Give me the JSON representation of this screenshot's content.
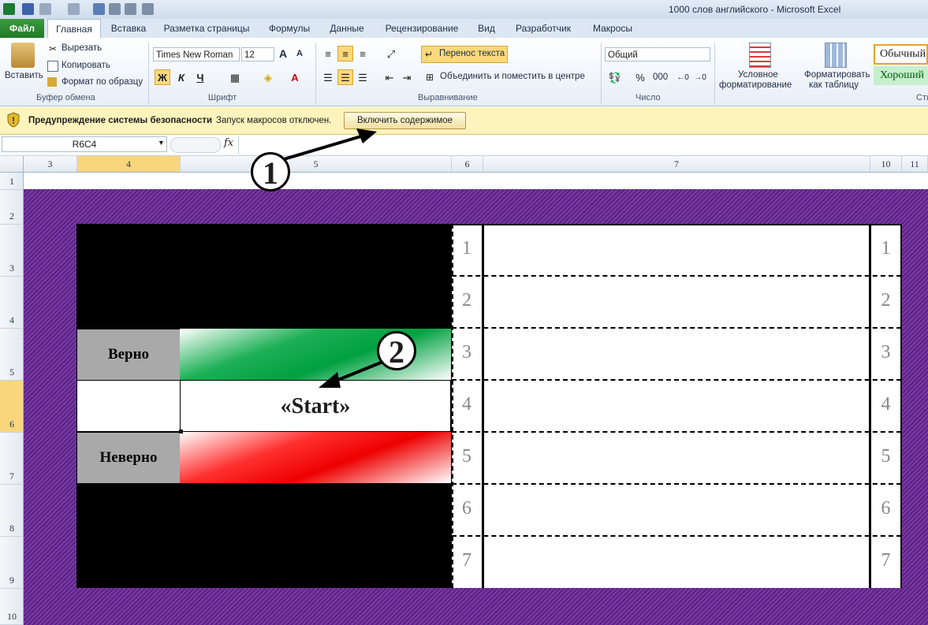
{
  "window": {
    "title": "1000 слов английского  -  Microsoft Excel"
  },
  "tabs": [
    "Главная",
    "Вставка",
    "Разметка страницы",
    "Формулы",
    "Данные",
    "Рецензирование",
    "Вид",
    "Разработчик",
    "Макросы"
  ],
  "file_tab": "Файл",
  "ribbon": {
    "clipboard": {
      "paste": "Вставить",
      "cut": "Вырезать",
      "copy": "Копировать",
      "format_painter": "Формат по образцу",
      "label": "Буфер обмена"
    },
    "font": {
      "name": "Times New Roman",
      "size": "12",
      "bold": "Ж",
      "italic": "К",
      "underline": "Ч",
      "label": "Шрифт"
    },
    "alignment": {
      "wrap": "Перенос текста",
      "merge": "Объединить и поместить в центре",
      "label": "Выравнивание"
    },
    "number": {
      "format": "Общий",
      "percent": "%",
      "thousands": "000",
      "label": "Число"
    },
    "styles": {
      "conditional": "Условное",
      "conditional2": "форматирование",
      "as_table": "Форматировать",
      "as_table2": "как таблицу",
      "normal": "Обычный",
      "good": "Хороший",
      "label": "Сти"
    }
  },
  "security": {
    "title": "Предупреждение системы безопасности",
    "message": "Запуск макросов отключен.",
    "button": "Включить содержимое"
  },
  "formula": {
    "name_box": "R6C4",
    "fx": "fx",
    "value": ""
  },
  "columns": [
    "3",
    "4",
    "5",
    "6",
    "7",
    "10",
    "11"
  ],
  "rows": [
    "1",
    "2",
    "3",
    "4",
    "5",
    "6",
    "7",
    "8",
    "9",
    "10"
  ],
  "sheet": {
    "correct": "Верно",
    "wrong": "Неверно",
    "start": "«Start»",
    "numbers": [
      "1",
      "2",
      "3",
      "4",
      "5",
      "6",
      "7"
    ]
  },
  "callouts": [
    "1",
    "2"
  ],
  "colors": {
    "frame": "#6a2b96",
    "selected_header": "#f9d67b",
    "security_bar": "#fdf3bd",
    "file_tab": "#2a8a30"
  }
}
